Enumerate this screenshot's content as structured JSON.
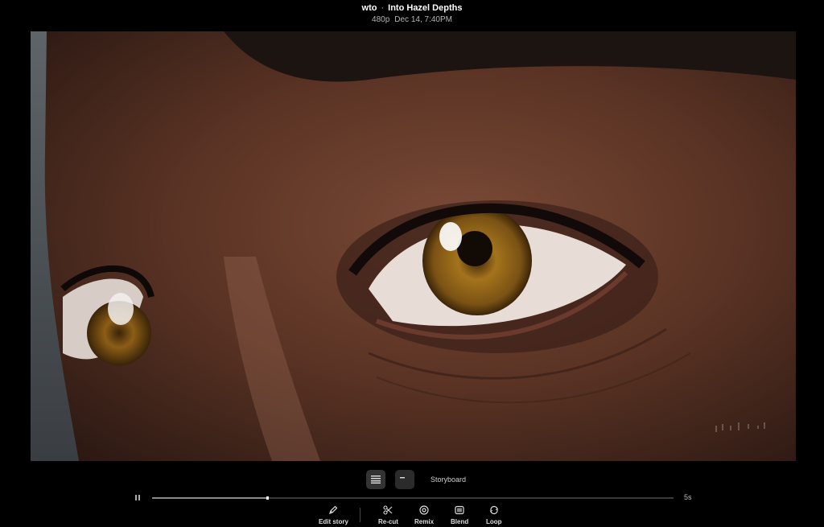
{
  "header": {
    "user": "wto",
    "separator": "·",
    "title": "Into Hazel Depths",
    "resolution": "480p",
    "date": "Dec 14, 7:40PM"
  },
  "video": {
    "description_icon": "close-up-eye-frame",
    "skin_color": "#5b3a2a",
    "iris_color": "#a4731c"
  },
  "view_toggle": {
    "list_icon": "list-icon",
    "storyboard_icon": "storyboard-icon",
    "label": "Storyboard"
  },
  "timeline": {
    "pause_icon": "pause-icon",
    "progress": 0.22,
    "duration": "5s"
  },
  "actions": [
    {
      "icon": "pencil-icon",
      "label": "Edit story"
    },
    {
      "icon": "scissors-icon",
      "label": "Re-cut"
    },
    {
      "icon": "remix-icon",
      "label": "Remix"
    },
    {
      "icon": "blend-icon",
      "label": "Blend"
    },
    {
      "icon": "loop-icon",
      "label": "Loop"
    }
  ]
}
